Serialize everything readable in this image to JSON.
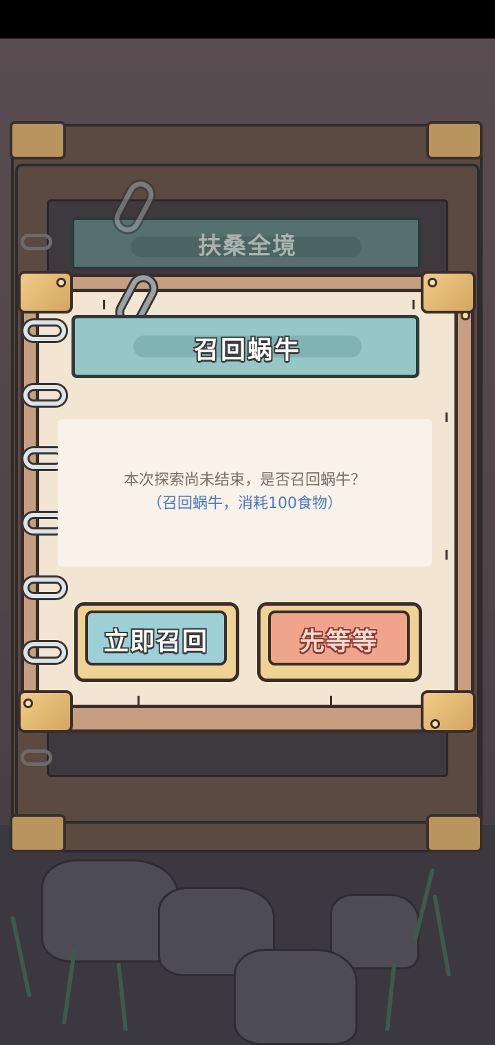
{
  "background": {
    "location_title": "扶桑全境"
  },
  "dialog": {
    "title": "召回蜗牛",
    "message": "本次探索尚未结束，是否召回蜗牛？",
    "cost_note": "（召回蜗牛，消耗100食物）",
    "confirm_label": "立即召回",
    "cancel_label": "先等等"
  },
  "colors": {
    "title_plate": "#95c7c6",
    "confirm_button": "#9cd0d6",
    "cancel_button": "#f0a48b",
    "cost_text": "#4a78c8",
    "page": "#f2e6d2"
  }
}
